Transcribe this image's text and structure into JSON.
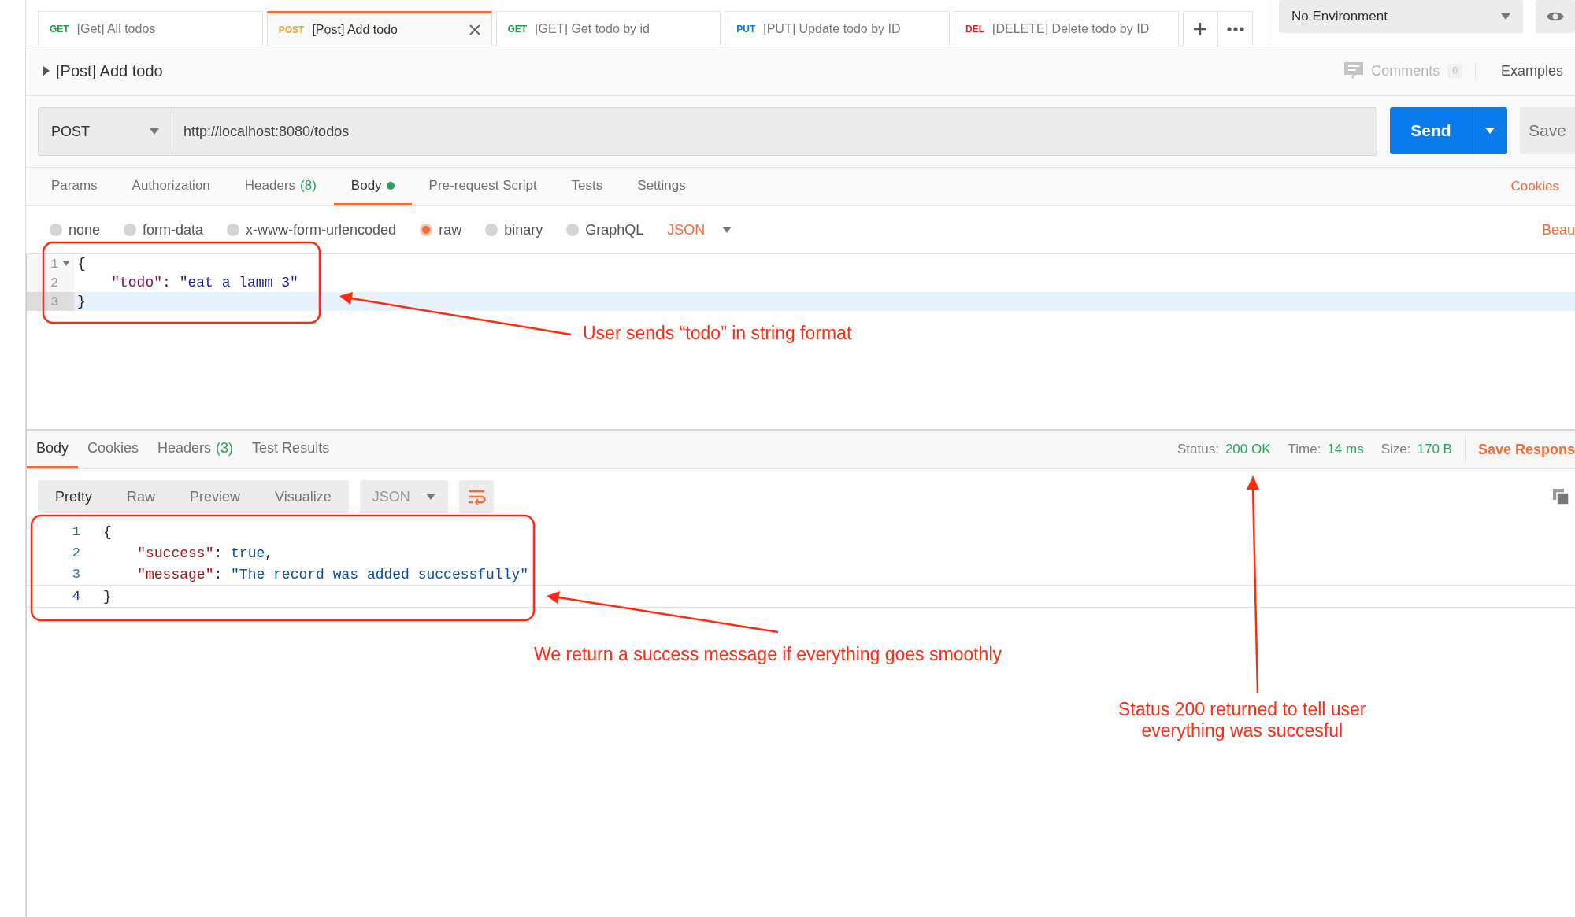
{
  "tabs": [
    {
      "method": "GET",
      "color": "#249c47",
      "title": "[Get] All todos",
      "selected": false
    },
    {
      "method": "POST",
      "color": "#f5a623",
      "title": "[Post] Add todo",
      "selected": true
    },
    {
      "method": "GET",
      "color": "#249c47",
      "title": "[GET] Get todo by id",
      "selected": false
    },
    {
      "method": "PUT",
      "color": "#097bed",
      "title": "[PUT] Update todo by ID",
      "selected": false
    },
    {
      "method": "DEL",
      "color": "#e51c1c",
      "title": "[DELETE] Delete todo by ID",
      "selected": false
    }
  ],
  "environment": {
    "label": "No Environment"
  },
  "request": {
    "title": "[Post] Add todo",
    "comments": "Comments",
    "comments_count": "0",
    "examples": "Examples",
    "method": "POST",
    "url": "http://localhost:8080/todos",
    "send": "Send",
    "save": "Save"
  },
  "request_tabs": [
    {
      "label": "Params",
      "selected": false
    },
    {
      "label": "Authorization",
      "selected": false
    },
    {
      "label": "Headers",
      "count": "(8)",
      "selected": false
    },
    {
      "label": "Body",
      "dot": true,
      "selected": true
    },
    {
      "label": "Pre-request Script",
      "selected": false
    },
    {
      "label": "Tests",
      "selected": false
    },
    {
      "label": "Settings",
      "selected": false
    }
  ],
  "cookies": "Cookies",
  "body_types": [
    {
      "label": "none",
      "selected": false
    },
    {
      "label": "form-data",
      "selected": false
    },
    {
      "label": "x-www-form-urlencoded",
      "selected": false
    },
    {
      "label": "raw",
      "selected": true
    },
    {
      "label": "binary",
      "selected": false
    },
    {
      "label": "GraphQL",
      "selected": false
    }
  ],
  "body_format": "JSON",
  "beautify": "Beau",
  "editor": {
    "lines": [
      {
        "number": "1",
        "foldable": true,
        "active": false,
        "tokens": [
          {
            "kind": "punct",
            "text": "{"
          }
        ]
      },
      {
        "number": "2",
        "foldable": false,
        "active": false,
        "tokens": [
          {
            "kind": "key",
            "text": "\"todo\""
          },
          {
            "kind": "punct",
            "text": ": "
          },
          {
            "kind": "string",
            "text": "\"eat a lamm 3\""
          }
        ]
      },
      {
        "number": "3",
        "foldable": false,
        "active": true,
        "tokens": [
          {
            "kind": "punct",
            "text": "}"
          }
        ]
      }
    ]
  },
  "response": {
    "tabs": [
      {
        "label": "Body",
        "selected": true
      },
      {
        "label": "Cookies",
        "selected": false
      },
      {
        "label": "Headers",
        "count": "(3)",
        "selected": false
      },
      {
        "label": "Test Results",
        "selected": false
      }
    ],
    "stats": [
      {
        "label": "Status:",
        "value": "200 OK"
      },
      {
        "label": "Time:",
        "value": "14 ms"
      },
      {
        "label": "Size:",
        "value": "170 B"
      }
    ],
    "save": "Save Respons",
    "view_tabs": [
      {
        "label": "Pretty",
        "selected": true
      },
      {
        "label": "Raw",
        "selected": false
      },
      {
        "label": "Preview",
        "selected": false
      },
      {
        "label": "Visualize",
        "selected": false
      }
    ],
    "format": "JSON",
    "lines": [
      {
        "number": "1",
        "tokens": [
          {
            "kind": "punct",
            "text": "{"
          }
        ]
      },
      {
        "number": "2",
        "tokens": [
          {
            "kind": "key",
            "text": "\"success\""
          },
          {
            "kind": "punct",
            "text": ": "
          },
          {
            "kind": "bool",
            "text": "true"
          },
          {
            "kind": "punct",
            "text": ","
          }
        ]
      },
      {
        "number": "3",
        "tokens": [
          {
            "kind": "key",
            "text": "\"message\""
          },
          {
            "kind": "punct",
            "text": ": "
          },
          {
            "kind": "string",
            "text": "\"The record was added successfully\""
          }
        ]
      },
      {
        "number": "4",
        "tokens": [
          {
            "kind": "punct",
            "text": "}"
          }
        ]
      }
    ]
  },
  "annotations": [
    {
      "lines": [
        "User sends “todo” in string format"
      ]
    },
    {
      "lines": [
        "We return a success message if everything goes smoothly"
      ]
    },
    {
      "lines": [
        "Status 200 returned to tell user",
        "everything was succesful"
      ]
    }
  ]
}
